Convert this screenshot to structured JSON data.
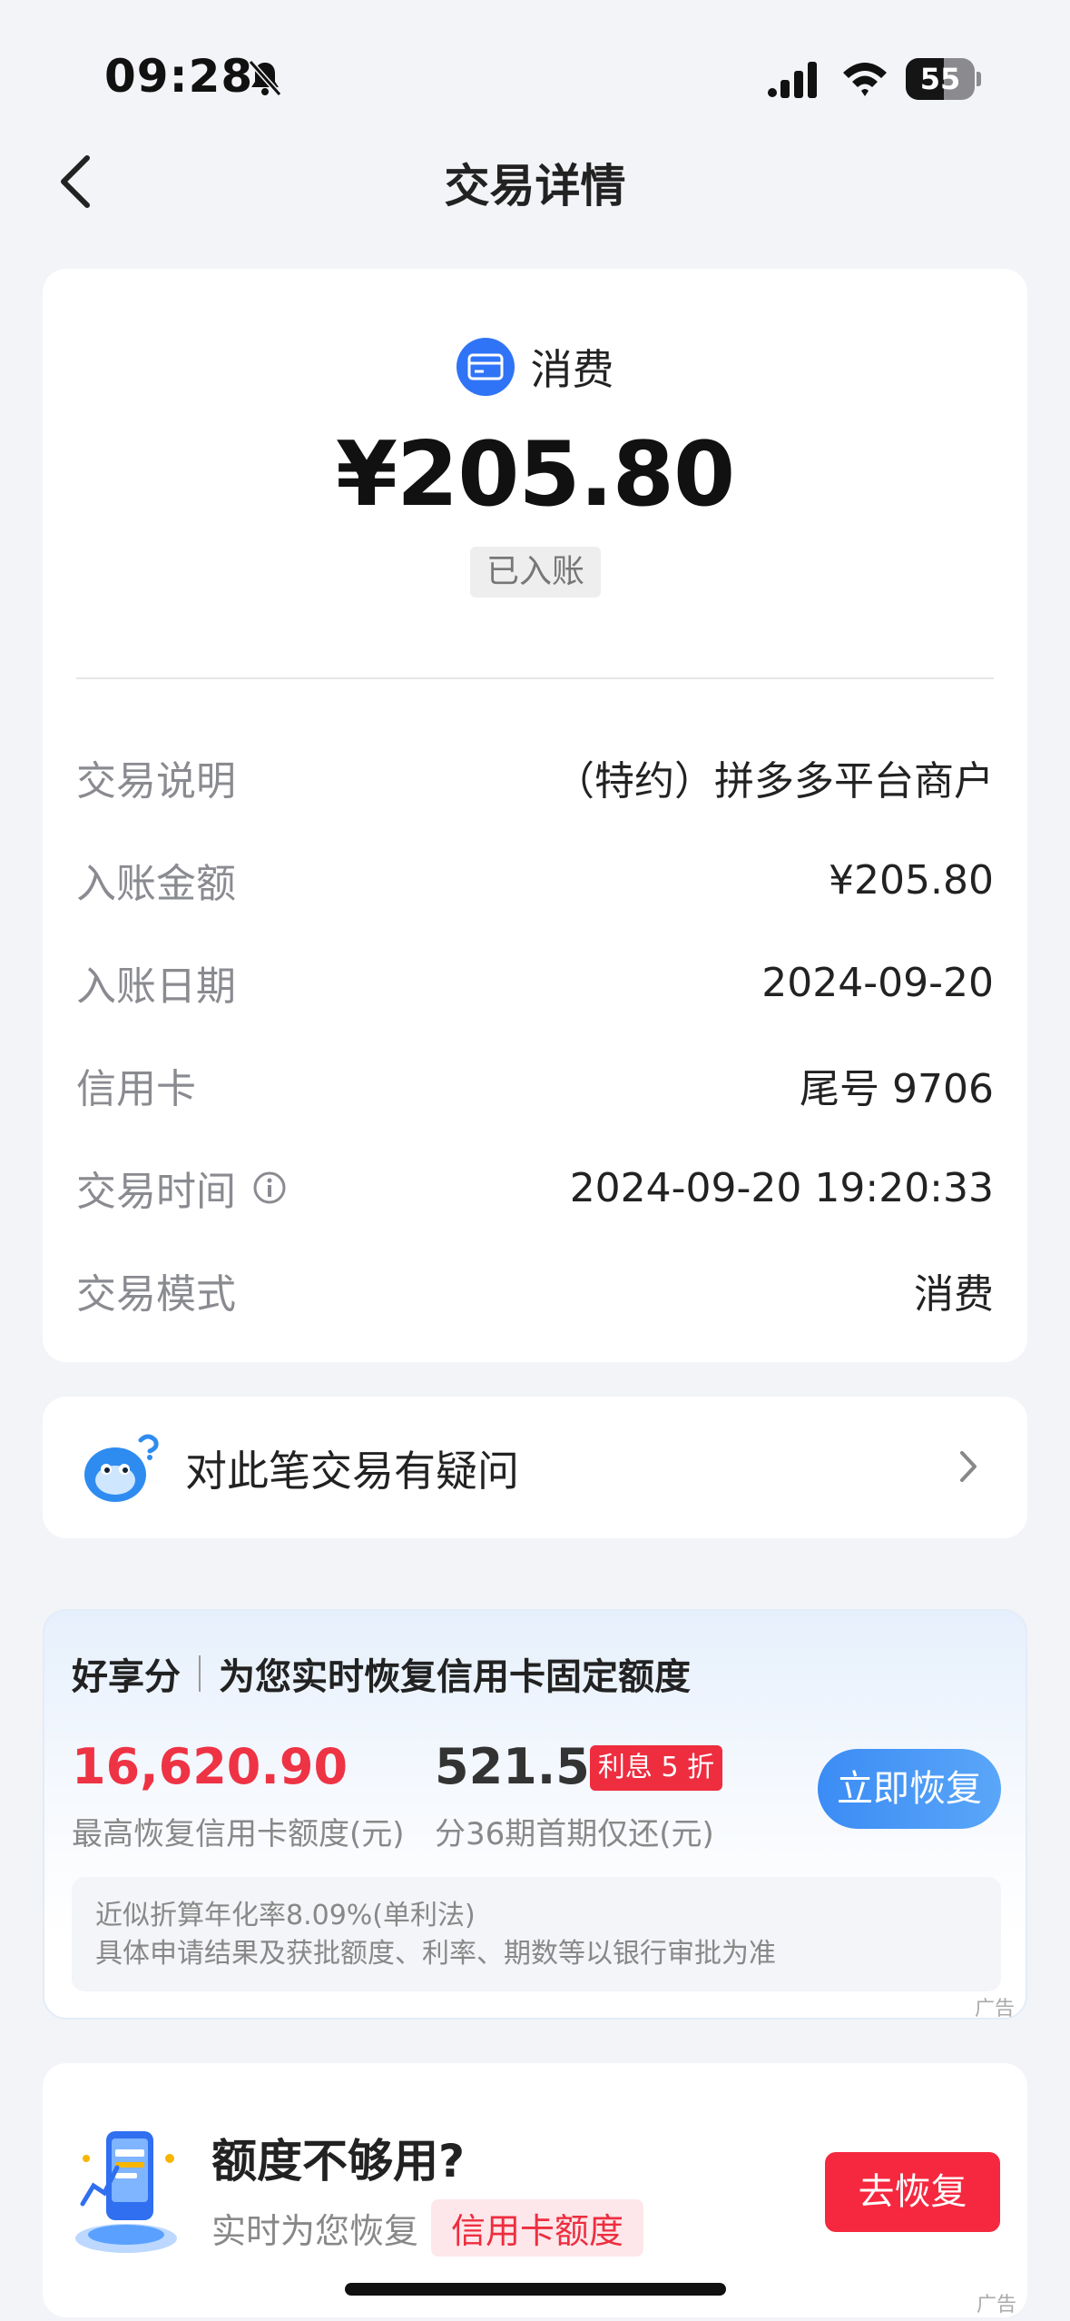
{
  "status_bar": {
    "time": "09:28",
    "battery": "55",
    "battery_level": 0.55
  },
  "nav": {
    "title": "交易详情"
  },
  "transaction": {
    "type_label": "消费",
    "amount": "¥205.80",
    "status": "已入账",
    "rows": [
      {
        "label": "交易说明",
        "value": "（特约）拼多多平台商户"
      },
      {
        "label": "入账金额",
        "value": "¥205.80"
      },
      {
        "label": "入账日期",
        "value": "2024-09-20"
      },
      {
        "label": "信用卡",
        "value": "尾号 9706"
      },
      {
        "label": "交易时间",
        "value": "2024-09-20 19:20:33"
      },
      {
        "label": "交易模式",
        "value": "消费"
      }
    ]
  },
  "question": {
    "label": "对此笔交易有疑问"
  },
  "loan_ad": {
    "brand": "好享分",
    "headline": "为您实时恢复信用卡固定额度",
    "credit_amount": "16,620.90",
    "credit_caption": "最高恢复信用卡额度(元)",
    "installment_amount": "521.52",
    "badge": "利息 5 折",
    "installment_caption": "分36期首期仅还(元)",
    "button": "立即恢复",
    "notice_line1": "近似折算年化率8.09%(单利法)",
    "notice_line2": "具体申请结果及获批额度、利率、期数等以银行审批为准",
    "ad_tag": "广告"
  },
  "limit_ad": {
    "title": "额度不够用?",
    "subtitle": "实时为您恢复",
    "chip": "信用卡额度",
    "button": "去恢复",
    "ad_tag": "广告"
  },
  "colors": {
    "accent_blue": "#2f74f6",
    "accent_red": "#ee2d3f"
  }
}
